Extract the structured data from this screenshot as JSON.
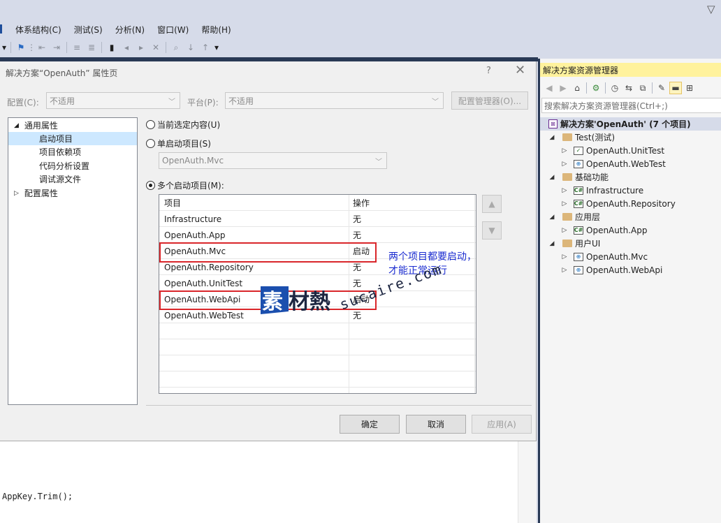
{
  "ide": {
    "menu": [
      "体系结构(C)",
      "测试(S)",
      "分析(N)",
      "窗口(W)",
      "帮助(H)"
    ]
  },
  "dialog": {
    "title": "解决方案“OpenAuth” 属性页",
    "help_glyph": "?",
    "close_glyph": "✕",
    "config_label": "配置(C):",
    "config_value": "不适用",
    "platform_label": "平台(P):",
    "platform_value": "不适用",
    "config_manager_button": "配置管理器(O)...",
    "tree": {
      "common": "通用属性",
      "items": [
        "启动项目",
        "项目依赖项",
        "代码分析设置",
        "调试源文件"
      ],
      "config_props": "配置属性"
    },
    "radio_current": "当前选定内容(U)",
    "radio_single": "单启动项目(S)",
    "single_value": "OpenAuth.Mvc",
    "radio_multiple": "多个启动项目(M):",
    "grid": {
      "col_project": "项目",
      "col_action": "操作",
      "rows": [
        {
          "project": "Infrastructure",
          "action": "无"
        },
        {
          "project": "OpenAuth.App",
          "action": "无"
        },
        {
          "project": "OpenAuth.Mvc",
          "action": "启动"
        },
        {
          "project": "OpenAuth.Repository",
          "action": "无"
        },
        {
          "project": "OpenAuth.UnitTest",
          "action": "无"
        },
        {
          "project": "OpenAuth.WebApi",
          "action": "启动"
        },
        {
          "project": "OpenAuth.WebTest",
          "action": "无"
        }
      ]
    },
    "annotation_line1": "两个项目都要启动，",
    "annotation_line2": "才能正常运行",
    "ok": "确定",
    "cancel": "取消",
    "apply": "应用(A)"
  },
  "watermark": {
    "logo_text": "素材熱",
    "url_text": "sucaire.com"
  },
  "editor": {
    "code_line": "AppKey.Trim();"
  },
  "solution_explorer": {
    "title": "解决方案资源管理器",
    "search_placeholder": "搜索解决方案资源管理器(Ctrl+;)",
    "solution": "解决方案'OpenAuth' (7 个项目)",
    "folders": [
      {
        "name": "Test(测试)",
        "projects": [
          {
            "name": "OpenAuth.UnitTest",
            "icon": "test"
          },
          {
            "name": "OpenAuth.WebTest",
            "icon": "web"
          }
        ]
      },
      {
        "name": "基础功能",
        "projects": [
          {
            "name": "Infrastructure",
            "icon": "cs"
          },
          {
            "name": "OpenAuth.Repository",
            "icon": "cs"
          }
        ]
      },
      {
        "name": "应用层",
        "projects": [
          {
            "name": "OpenAuth.App",
            "icon": "cs"
          }
        ]
      },
      {
        "name": "用户UI",
        "projects": [
          {
            "name": "OpenAuth.Mvc",
            "icon": "web"
          },
          {
            "name": "OpenAuth.WebApi",
            "icon": "web"
          }
        ]
      }
    ]
  },
  "colors": {
    "highlight_box": "#d9262a",
    "annotation": "#1a2bd0",
    "se_title_bg": "#fff29d",
    "ide_band": "#293955"
  }
}
